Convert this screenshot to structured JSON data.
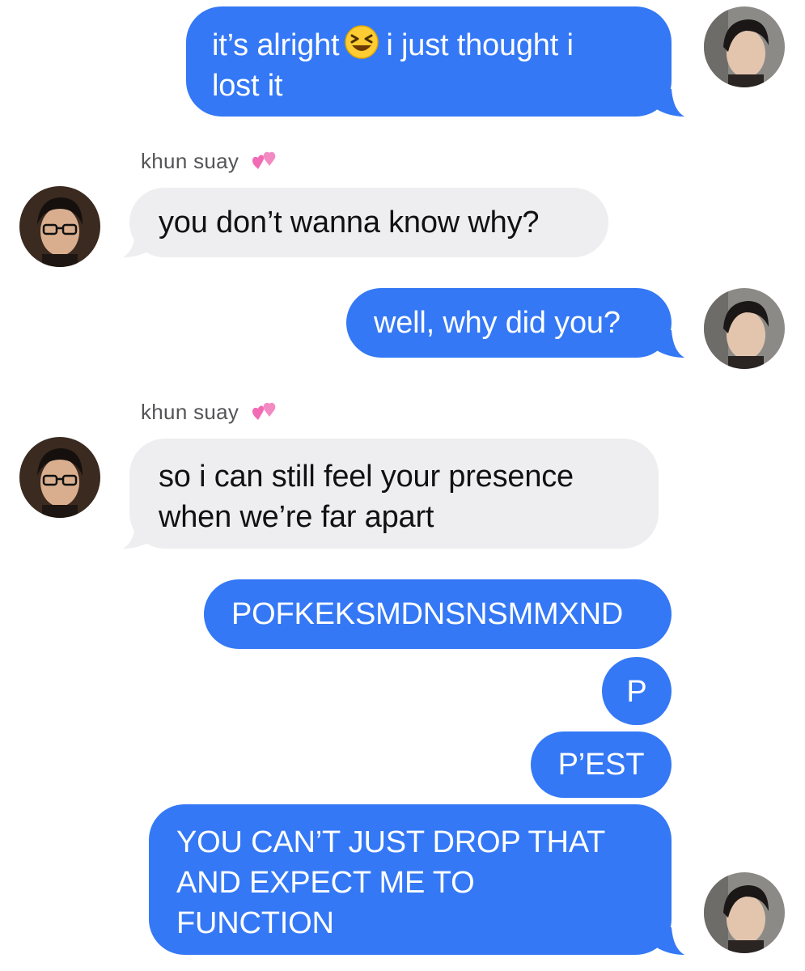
{
  "thread": {
    "messages": [
      {
        "from": "me",
        "text_before_emoji": "it’s alright",
        "emoji": "laughing-squint-emoji",
        "text_after_emoji_line1": "i just thought i",
        "text_line2": "lost it"
      },
      {
        "from": "khun suay",
        "sender_label": "khun suay",
        "sender_icon": "two-hearts-icon",
        "text": "you don’t wanna know why?"
      },
      {
        "from": "me",
        "text": "well, why did you?"
      },
      {
        "from": "khun suay",
        "sender_label": "khun suay",
        "sender_icon": "two-hearts-icon",
        "line1": "so i can still feel your presence",
        "line2": "when we’re far apart"
      },
      {
        "from": "me",
        "text": "POFKEKSMDNSNSMMXND"
      },
      {
        "from": "me",
        "text": "P"
      },
      {
        "from": "me",
        "text": "P’EST"
      },
      {
        "from": "me",
        "line1": "YOU CAN’T JUST DROP THAT",
        "line2": "AND EXPECT ME TO",
        "line3": "FUNCTION"
      }
    ]
  },
  "colors": {
    "sent_bubble": "#3478F6",
    "received_bubble": "#EEEEF0",
    "sender_label": "#555558",
    "heart": "#F26BB5"
  }
}
